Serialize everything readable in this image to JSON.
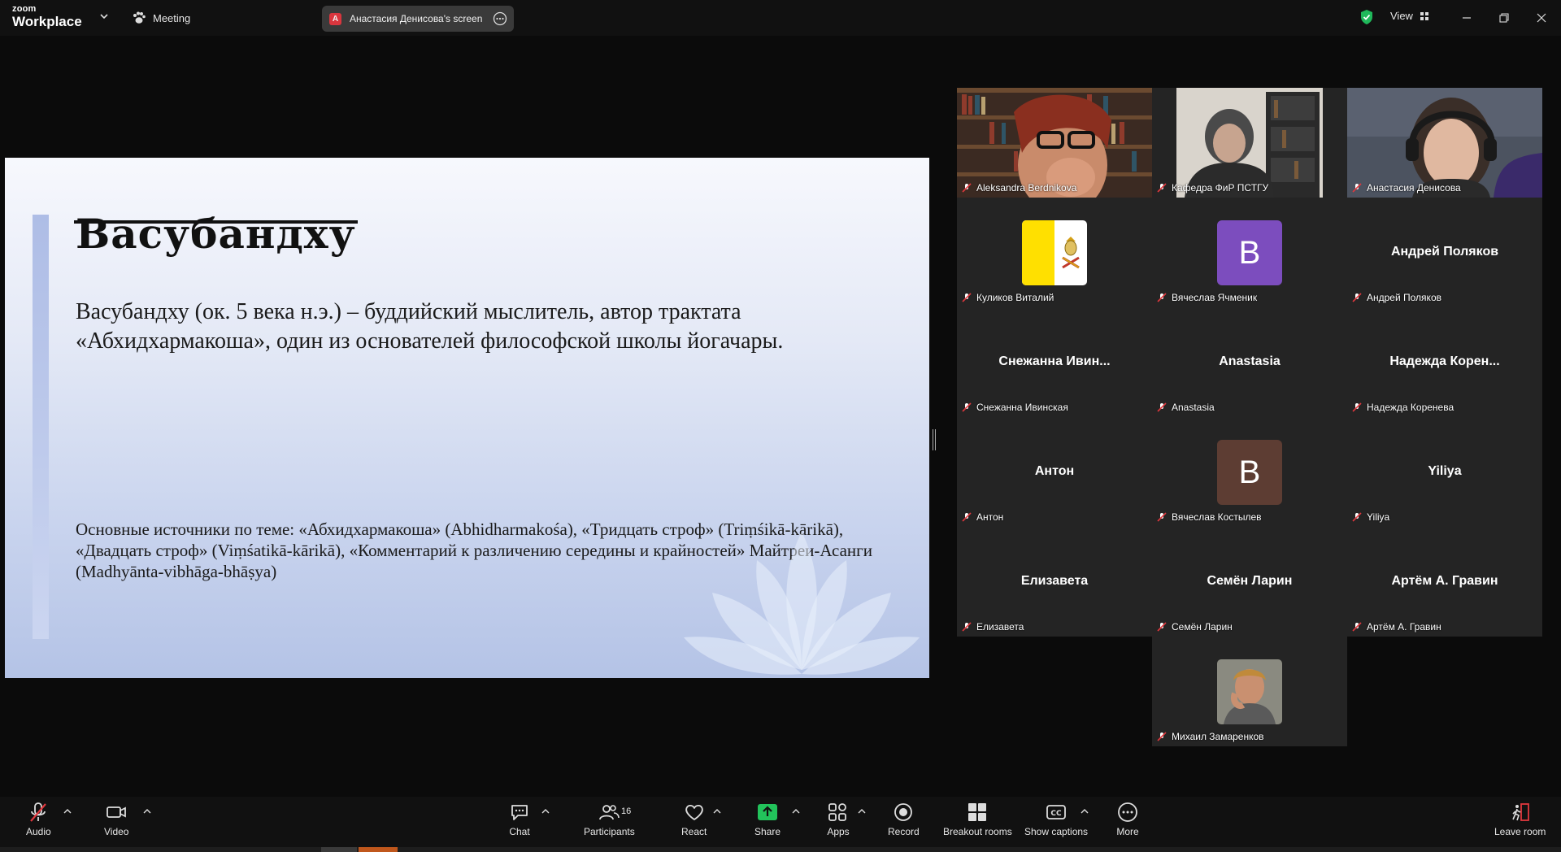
{
  "app": {
    "brand_top": "zoom",
    "brand_bottom": "Workplace",
    "meeting_label": "Meeting",
    "share_avatar_letter": "A",
    "share_label": "Анастасия Денисова's screen",
    "view_label": "View"
  },
  "slide": {
    "title": "Васубандху",
    "body": "Васубандху (ок. 5 века н.э.) – буддийский мыслитель, автор трактата «Абхидхармакоша», один из основателей философской школы йогачары.",
    "sources": "Основные источники по теме: «Абхидхармакоша» (Abhidharmakośa), «Тридцать строф» (Triṃśikā-kārikā), «Двадцать строф» (Viṃśatikā-kārikā), «Комментарий к различению середины и крайностей» Майтреи-Асанги (Madhyānta-vibhāga-bhāṣya)"
  },
  "participants": [
    {
      "name": "Aleksandra Berdnikova",
      "kind": "video"
    },
    {
      "name": "Кафедра ФиР ПСТГУ",
      "kind": "video"
    },
    {
      "name": "Анастасия Денисова",
      "kind": "video",
      "active": true
    },
    {
      "name": "Куликов Виталий",
      "kind": "flag"
    },
    {
      "name": "Вячеслав Ячменик",
      "kind": "avatar",
      "letter": "B",
      "color": "#7c4dbe"
    },
    {
      "name": "Андрей Поляков",
      "kind": "text",
      "display": "Андрей Поляков"
    },
    {
      "name": "Снежанна Ивинская",
      "kind": "text",
      "display": "Снежанна  Ивин..."
    },
    {
      "name": "Anastasia",
      "kind": "text",
      "display": "Anastasia"
    },
    {
      "name": "Надежда Коренева",
      "kind": "text",
      "display": "Надежда  Корен..."
    },
    {
      "name": "Антон",
      "kind": "text",
      "display": "Антон"
    },
    {
      "name": "Вячеслав Костылев",
      "kind": "avatar",
      "letter": "B",
      "color": "#5d3d33"
    },
    {
      "name": "Yiliya",
      "kind": "text",
      "display": "Yiliya"
    },
    {
      "name": "Елизавета",
      "kind": "text",
      "display": "Елизавета"
    },
    {
      "name": "Семён Ларин",
      "kind": "text",
      "display": "Семён Ларин"
    },
    {
      "name": "Артём А. Гравин",
      "kind": "text",
      "display": "Артём А. Гравин"
    },
    {
      "name": "Михаил Замаренков",
      "kind": "video"
    }
  ],
  "toolbar": {
    "audio": "Audio",
    "video": "Video",
    "chat": "Chat",
    "participants": "Participants",
    "participants_count": "16",
    "react": "React",
    "share": "Share",
    "apps": "Apps",
    "record": "Record",
    "breakout": "Breakout rooms",
    "captions": "Show captions",
    "more": "More",
    "leave": "Leave room"
  },
  "colors": {
    "active_speaker": "#26d07c",
    "share_green": "#22c35b",
    "muted_red": "#e0383e",
    "shield_green": "#1fb85a"
  }
}
